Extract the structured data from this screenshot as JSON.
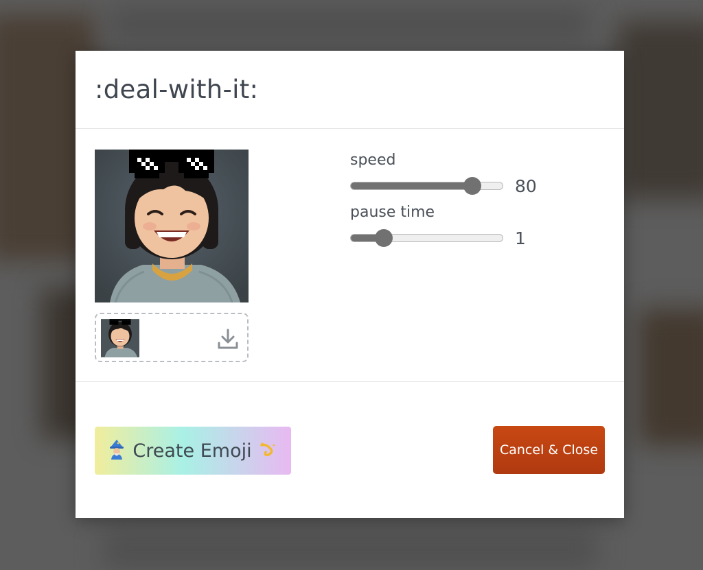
{
  "modal": {
    "title": ":deal-with-it:"
  },
  "controls": {
    "speed": {
      "label": "speed",
      "value": "80",
      "fraction": 0.8
    },
    "pause_time": {
      "label": "pause time",
      "value": "1",
      "fraction": 0.22
    }
  },
  "icons": {
    "download": "download-icon",
    "create_left": "wizard-icon",
    "create_right": "sparkle-swirl-icon"
  },
  "footer": {
    "create_label": "Create Emoji",
    "cancel_label": "Cancel & Close"
  },
  "colors": {
    "cancel_button": "#bb4010",
    "slider_fill": "#717171",
    "title_text": "#3f4650"
  }
}
